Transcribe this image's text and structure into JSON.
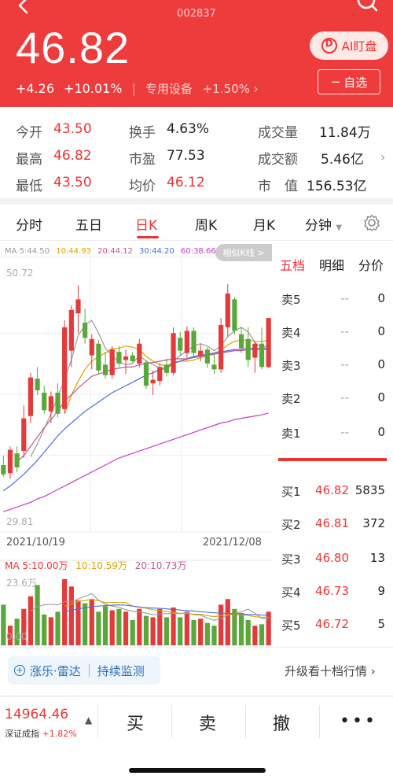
{
  "header": {
    "stock_code": "002837",
    "price": "46.82",
    "change": "+4.26",
    "change_pct": "+10.01%",
    "sector": "专用设备",
    "sector_change": "+1.50%",
    "ai_label": "AI盯盘",
    "watch_label": "自选"
  },
  "stats": {
    "open_label": "今开",
    "open": "43.50",
    "high_label": "最高",
    "high": "46.82",
    "low_label": "最低",
    "low": "43.50",
    "turnover_label": "换手",
    "turnover": "4.63%",
    "pe_label": "市盈",
    "pe": "77.53",
    "avg_label": "均价",
    "avg": "46.12",
    "volume_label": "成交量",
    "volume": "11.84万",
    "amount_label": "成交额",
    "amount": "5.46亿",
    "mcap_label": "市　值",
    "mcap": "156.53亿"
  },
  "tabs": [
    "分时",
    "五日",
    "日K",
    "周K",
    "月K",
    "分钟"
  ],
  "active_tab": "日K",
  "chart_legend": {
    "ma5": "MA 5:44.50",
    "ma10": "10:44.93",
    "ma20": "20:44.12",
    "ma30": "30:44.20",
    "ma60": "60:38.66"
  },
  "similar_label": "相似K线 >",
  "axis": {
    "top": "50.72",
    "bottom": "29.81",
    "date_start": "2021/10/19",
    "date_end": "2021/12/08",
    "vol_top": "23.6万",
    "vol_bottom": "0.00"
  },
  "vol_legend": {
    "ma5": "MA 5:10.00万",
    "ma10": "10:10.59万",
    "ma20": "20:10.73万"
  },
  "colors": {
    "up": "#e33b3b",
    "down": "#5ba83a",
    "ma5": "#999999",
    "ma10": "#d9a400",
    "ma20": "#c0569b",
    "ma30": "#4a6fd6",
    "ma60": "#c040c0"
  },
  "book": {
    "tabs": [
      "五档",
      "明细",
      "分价"
    ],
    "active": "五档",
    "sells": [
      {
        "label": "卖5",
        "price": "--",
        "vol": "0"
      },
      {
        "label": "卖4",
        "price": "--",
        "vol": "0"
      },
      {
        "label": "卖3",
        "price": "--",
        "vol": "0"
      },
      {
        "label": "卖2",
        "price": "--",
        "vol": "0"
      },
      {
        "label": "卖1",
        "price": "--",
        "vol": "0"
      }
    ],
    "buys": [
      {
        "label": "买1",
        "price": "46.82",
        "vol": "5835"
      },
      {
        "label": "买2",
        "price": "46.81",
        "vol": "372"
      },
      {
        "label": "买3",
        "price": "46.80",
        "vol": "13"
      },
      {
        "label": "买4",
        "price": "46.73",
        "vol": "9"
      },
      {
        "label": "买5",
        "price": "46.72",
        "vol": "5"
      }
    ]
  },
  "radar": {
    "left": "涨乐·雷达",
    "right": "持续监测"
  },
  "upgrade_label": "升级看十档行情",
  "bottom": {
    "index_value": "14964.46",
    "index_name": "深证成指",
    "index_change": "+1.82%",
    "buy": "买",
    "sell": "卖",
    "cancel": "撤",
    "more": "•••"
  },
  "chart_data": {
    "type": "candlestick",
    "title": "",
    "ylim": [
      29.81,
      50.72
    ],
    "x_start": "2021/10/19",
    "x_end": "2021/12/08",
    "candles": [
      {
        "o": 34.2,
        "h": 35.0,
        "l": 33.2,
        "c": 33.4
      },
      {
        "o": 33.5,
        "h": 35.8,
        "l": 33.0,
        "c": 35.5
      },
      {
        "o": 35.2,
        "h": 35.8,
        "l": 33.6,
        "c": 34.0
      },
      {
        "o": 35.4,
        "h": 39.3,
        "l": 34.8,
        "c": 38.2
      },
      {
        "o": 38.4,
        "h": 42.1,
        "l": 37.8,
        "c": 41.7
      },
      {
        "o": 41.6,
        "h": 42.6,
        "l": 40.2,
        "c": 40.6
      },
      {
        "o": 40.4,
        "h": 41.0,
        "l": 38.6,
        "c": 38.9
      },
      {
        "o": 38.8,
        "h": 40.5,
        "l": 37.8,
        "c": 40.1
      },
      {
        "o": 40.4,
        "h": 41.2,
        "l": 38.3,
        "c": 38.6
      },
      {
        "o": 39.0,
        "h": 46.6,
        "l": 38.6,
        "c": 46.0
      },
      {
        "o": 44.0,
        "h": 47.9,
        "l": 42.6,
        "c": 47.5
      },
      {
        "o": 47.2,
        "h": 49.6,
        "l": 45.5,
        "c": 48.4
      },
      {
        "o": 46.4,
        "h": 47.6,
        "l": 44.6,
        "c": 45.1
      },
      {
        "o": 43.6,
        "h": 45.4,
        "l": 42.4,
        "c": 45.0
      },
      {
        "o": 44.6,
        "h": 44.9,
        "l": 42.0,
        "c": 42.3
      },
      {
        "o": 42.8,
        "h": 43.9,
        "l": 41.6,
        "c": 41.9
      },
      {
        "o": 41.9,
        "h": 44.4,
        "l": 41.6,
        "c": 44.1
      },
      {
        "o": 43.9,
        "h": 44.4,
        "l": 42.6,
        "c": 42.9
      },
      {
        "o": 43.2,
        "h": 44.1,
        "l": 42.0,
        "c": 43.5
      },
      {
        "o": 43.6,
        "h": 43.9,
        "l": 43.0,
        "c": 43.1
      },
      {
        "o": 42.9,
        "h": 45.0,
        "l": 42.6,
        "c": 44.6
      },
      {
        "o": 43.0,
        "h": 43.2,
        "l": 40.7,
        "c": 41.0
      },
      {
        "o": 41.2,
        "h": 42.3,
        "l": 40.2,
        "c": 41.5
      },
      {
        "o": 41.4,
        "h": 42.9,
        "l": 41.0,
        "c": 42.6
      },
      {
        "o": 42.8,
        "h": 43.3,
        "l": 41.8,
        "c": 42.1
      },
      {
        "o": 42.1,
        "h": 46.0,
        "l": 41.9,
        "c": 45.5
      },
      {
        "o": 45.1,
        "h": 45.6,
        "l": 43.6,
        "c": 44.0
      },
      {
        "o": 43.8,
        "h": 46.1,
        "l": 43.2,
        "c": 45.7
      },
      {
        "o": 45.7,
        "h": 46.0,
        "l": 43.4,
        "c": 43.8
      },
      {
        "o": 43.6,
        "h": 44.6,
        "l": 43.1,
        "c": 44.0
      },
      {
        "o": 44.1,
        "h": 44.3,
        "l": 42.5,
        "c": 42.9
      },
      {
        "o": 42.8,
        "h": 43.8,
        "l": 42.0,
        "c": 42.4
      },
      {
        "o": 42.4,
        "h": 46.8,
        "l": 42.1,
        "c": 46.2
      },
      {
        "o": 46.0,
        "h": 49.7,
        "l": 45.2,
        "c": 48.9
      },
      {
        "o": 48.4,
        "h": 48.6,
        "l": 45.4,
        "c": 45.7
      },
      {
        "o": 45.4,
        "h": 46.0,
        "l": 43.8,
        "c": 44.2
      },
      {
        "o": 45.0,
        "h": 46.0,
        "l": 42.6,
        "c": 43.2
      },
      {
        "o": 43.4,
        "h": 44.8,
        "l": 42.1,
        "c": 44.6
      },
      {
        "o": 44.6,
        "h": 46.0,
        "l": 42.4,
        "c": 42.6
      },
      {
        "o": 42.6,
        "h": 46.8,
        "l": 42.5,
        "c": 46.8
      }
    ],
    "ma": [
      {
        "name": "MA5",
        "values": [
          null,
          null,
          null,
          null,
          34.9,
          36.0,
          37.3,
          38.6,
          40.0,
          41.6,
          43.2,
          45.3,
          46.2,
          46.6,
          45.5,
          44.2,
          43.6,
          43.0,
          42.8,
          42.9,
          43.6,
          43.1,
          42.8,
          42.5,
          42.3,
          43.1,
          43.6,
          44.0,
          44.4,
          44.6,
          44.4,
          44.0,
          44.4,
          45.2,
          45.7,
          46.0,
          45.6,
          44.7,
          44.2,
          44.5
        ]
      },
      {
        "name": "MA10",
        "values": [
          null,
          null,
          null,
          null,
          null,
          null,
          null,
          null,
          null,
          38.6,
          40.2,
          41.4,
          42.4,
          43.1,
          43.5,
          43.8,
          44.2,
          44.2,
          44.4,
          44.3,
          44.1,
          43.5,
          43.1,
          42.8,
          42.7,
          43.0,
          43.1,
          43.1,
          43.2,
          43.4,
          43.6,
          43.8,
          44.0,
          44.5,
          44.8,
          44.9,
          44.9,
          44.8,
          44.8,
          44.9
        ]
      },
      {
        "name": "MA20",
        "values": [
          null,
          null,
          34.5,
          35.0,
          35.8,
          36.6,
          37.4,
          38.1,
          38.8,
          39.7,
          40.2,
          40.8,
          41.3,
          41.8,
          42.0,
          42.2,
          42.4,
          42.5,
          42.6,
          42.6,
          42.8,
          42.9,
          43.0,
          43.1,
          43.2,
          43.3,
          43.3,
          43.3,
          43.4,
          43.5,
          43.6,
          43.7,
          43.8,
          43.9,
          44.0,
          44.0,
          44.1,
          44.1,
          44.1,
          44.1
        ]
      },
      {
        "name": "MA30",
        "values": [
          32.0,
          32.4,
          32.9,
          33.4,
          34.0,
          34.6,
          35.3,
          36.0,
          36.7,
          37.3,
          37.8,
          38.3,
          38.8,
          39.2,
          39.6,
          40.0,
          40.4,
          40.7,
          41.0,
          41.3,
          41.6,
          41.9,
          42.1,
          42.4,
          42.6,
          42.9,
          43.1,
          43.3,
          43.5,
          43.6,
          43.7,
          43.8,
          43.9,
          44.0,
          44.1,
          44.1,
          44.2,
          44.2,
          44.2,
          44.2
        ]
      },
      {
        "name": "MA60",
        "values": [
          30.2,
          30.4,
          30.6,
          30.8,
          31.0,
          31.3,
          31.5,
          31.8,
          32.1,
          32.4,
          32.7,
          33.0,
          33.3,
          33.6,
          33.9,
          34.2,
          34.5,
          34.8,
          35.0,
          35.2,
          35.4,
          35.6,
          35.8,
          36.0,
          36.2,
          36.4,
          36.6,
          36.8,
          37.0,
          37.2,
          37.4,
          37.6,
          37.8,
          37.9,
          38.1,
          38.2,
          38.3,
          38.4,
          38.5,
          38.66
        ]
      }
    ],
    "volume": [
      14.5,
      7.0,
      9.5,
      13.0,
      17.5,
      21.5,
      11.0,
      10.0,
      12.0,
      23.6,
      21.0,
      16.0,
      15.0,
      16.5,
      12.0,
      14.0,
      12.5,
      13.0,
      12.0,
      9.0,
      13.0,
      10.5,
      10.0,
      13.0,
      10.0,
      13.5,
      10.0,
      12.0,
      9.0,
      9.5,
      8.0,
      7.0,
      14.5,
      16.5,
      13.0,
      11.5,
      9.0,
      7.0,
      7.5,
      12.0
    ],
    "vol_ylim": [
      0,
      23.6
    ],
    "vol_ma": [
      {
        "name": "MA5",
        "values": [
          null,
          null,
          null,
          null,
          12.3,
          13.7,
          14.5,
          14.6,
          14.4,
          15.6,
          15.6,
          16.5,
          17.5,
          18.4,
          16.1,
          14.7,
          14.0,
          13.6,
          12.7,
          12.1,
          11.9,
          11.5,
          10.9,
          11.1,
          11.3,
          11.4,
          11.3,
          11.7,
          10.9,
          10.8,
          9.7,
          8.9,
          9.6,
          10.7,
          11.4,
          11.9,
          12.9,
          11.4,
          9.6,
          9.4
        ]
      },
      {
        "name": "MA10",
        "values": [
          null,
          null,
          null,
          null,
          null,
          null,
          null,
          null,
          null,
          14.0,
          14.7,
          15.6,
          16.0,
          16.4,
          15.9,
          15.2,
          15.3,
          15.3,
          15.3,
          14.0,
          13.7,
          13.2,
          12.7,
          12.4,
          12.1,
          11.8,
          11.4,
          11.4,
          11.1,
          11.1,
          10.6,
          10.2,
          10.6,
          10.9,
          11.0,
          10.8,
          10.7,
          10.2,
          10.0,
          10.0
        ]
      },
      {
        "name": "MA20",
        "values": [
          null,
          null,
          null,
          null,
          null,
          null,
          null,
          null,
          null,
          12.0,
          12.5,
          13.0,
          13.4,
          13.8,
          14.0,
          14.2,
          14.3,
          14.4,
          14.3,
          14.0,
          13.6,
          13.4,
          13.3,
          13.2,
          13.0,
          12.8,
          12.6,
          12.4,
          12.2,
          12.0,
          11.8,
          11.6,
          11.5,
          11.4,
          11.3,
          11.2,
          11.0,
          10.9,
          10.8,
          10.73
        ]
      }
    ]
  }
}
